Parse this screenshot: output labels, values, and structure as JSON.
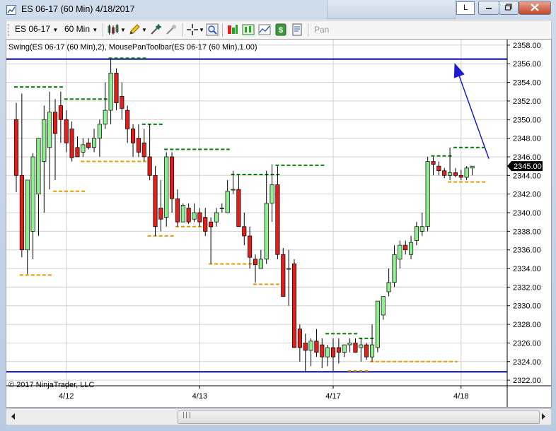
{
  "window": {
    "title": "ES 06-17 (60 Min)  4/18/2017",
    "l_button": "L"
  },
  "toolbar": {
    "instrument": "ES 06-17",
    "interval": "60 Min",
    "pan_label": "Pan"
  },
  "chart": {
    "indicator_label": "Swing(ES 06-17 (60 Min),2), MousePanToolbar(ES 06-17 (60 Min),1.00)",
    "copyright": "© 2017 NinjaTrader, LLC",
    "current_price_label": "2345.00",
    "colors": {
      "up": "#90ee90",
      "down": "#e0201c",
      "swing_high": "#008000",
      "swing_low": "#e89a00",
      "horizontal_line": "#0000a0",
      "arrow": "#1c1cd0",
      "grid": "#d0d0d0"
    }
  },
  "chart_data": {
    "type": "candlestick",
    "symbol": "ES 06-17",
    "interval": "60 Min",
    "ylim": [
      2321.4,
      2358.6
    ],
    "y_ticks": [
      2322.0,
      2324.0,
      2326.0,
      2328.0,
      2330.0,
      2332.0,
      2334.0,
      2336.0,
      2338.0,
      2340.0,
      2342.0,
      2344.0,
      2346.0,
      2348.0,
      2350.0,
      2352.0,
      2354.0,
      2356.0,
      2358.0
    ],
    "y_tick_labels": [
      "2322.00",
      "2324.00",
      "2326.00",
      "2328.00",
      "2330.00",
      "2332.00",
      "2334.00",
      "2336.00",
      "2338.00",
      "2340.00",
      "2342.00",
      "2344.00",
      "2346.00",
      "2348.00",
      "2350.00",
      "2352.00",
      "2354.00",
      "2356.00",
      "2358.00"
    ],
    "x_ticks": [
      {
        "bar": 9,
        "label": "4/12"
      },
      {
        "bar": 33,
        "label": "4/13"
      },
      {
        "bar": 57,
        "label": "4/17"
      },
      {
        "bar": 80,
        "label": "4/18"
      }
    ],
    "candles": [
      {
        "o": 2350.0,
        "h": 2351.8,
        "l": 2342.2,
        "c": 2344.0
      },
      {
        "o": 2344.0,
        "h": 2352.8,
        "l": 2335.2,
        "c": 2336.0
      },
      {
        "o": 2336.0,
        "h": 2342.5,
        "l": 2333.4,
        "c": 2343.5
      },
      {
        "o": 2338.0,
        "h": 2346.4,
        "l": 2335.0,
        "c": 2346.0
      },
      {
        "o": 2342.0,
        "h": 2348.0,
        "l": 2337.5,
        "c": 2348.0
      },
      {
        "o": 2345.5,
        "h": 2351.5,
        "l": 2340.0,
        "c": 2350.0
      },
      {
        "o": 2347.0,
        "h": 2353.0,
        "l": 2342.5,
        "c": 2350.8
      },
      {
        "o": 2350.8,
        "h": 2352.2,
        "l": 2343.5,
        "c": 2348.5
      },
      {
        "o": 2351.5,
        "h": 2353.0,
        "l": 2347.5,
        "c": 2350.0
      },
      {
        "o": 2350.0,
        "h": 2351.0,
        "l": 2346.5,
        "c": 2347.5
      },
      {
        "o": 2349.0,
        "h": 2349.8,
        "l": 2345.5,
        "c": 2345.9
      },
      {
        "o": 2347.0,
        "h": 2348.2,
        "l": 2346.0,
        "c": 2346.0
      },
      {
        "o": 2346.5,
        "h": 2348.0,
        "l": 2346.0,
        "c": 2347.3
      },
      {
        "o": 2347.5,
        "h": 2348.0,
        "l": 2346.8,
        "c": 2347.0
      },
      {
        "o": 2347.0,
        "h": 2349.0,
        "l": 2346.5,
        "c": 2348.0
      },
      {
        "o": 2348.0,
        "h": 2350.0,
        "l": 2346.0,
        "c": 2349.5
      },
      {
        "o": 2349.5,
        "h": 2354.0,
        "l": 2349.0,
        "c": 2351.0
      },
      {
        "o": 2351.0,
        "h": 2356.5,
        "l": 2349.5,
        "c": 2355.0
      },
      {
        "o": 2355.0,
        "h": 2355.5,
        "l": 2351.0,
        "c": 2351.8
      },
      {
        "o": 2352.5,
        "h": 2354.0,
        "l": 2350.0,
        "c": 2351.2
      },
      {
        "o": 2351.0,
        "h": 2351.5,
        "l": 2347.5,
        "c": 2349.0
      },
      {
        "o": 2349.0,
        "h": 2349.5,
        "l": 2346.0,
        "c": 2347.5
      },
      {
        "o": 2348.0,
        "h": 2349.5,
        "l": 2346.0,
        "c": 2346.5
      },
      {
        "o": 2347.5,
        "h": 2349.0,
        "l": 2345.5,
        "c": 2346.0
      },
      {
        "o": 2346.0,
        "h": 2349.5,
        "l": 2343.5,
        "c": 2344.0
      },
      {
        "o": 2344.0,
        "h": 2345.0,
        "l": 2337.5,
        "c": 2338.5
      },
      {
        "o": 2340.5,
        "h": 2343.5,
        "l": 2338.0,
        "c": 2339.3
      },
      {
        "o": 2339.5,
        "h": 2346.5,
        "l": 2338.5,
        "c": 2346.0
      },
      {
        "o": 2346.0,
        "h": 2346.5,
        "l": 2340.0,
        "c": 2341.5
      },
      {
        "o": 2341.5,
        "h": 2342.5,
        "l": 2338.5,
        "c": 2339.0
      },
      {
        "o": 2339.0,
        "h": 2341.0,
        "l": 2339.0,
        "c": 2340.8
      },
      {
        "o": 2340.5,
        "h": 2341.0,
        "l": 2338.8,
        "c": 2339.0
      },
      {
        "o": 2339.3,
        "h": 2341.0,
        "l": 2339.0,
        "c": 2340.0
      },
      {
        "o": 2340.0,
        "h": 2340.5,
        "l": 2338.5,
        "c": 2339.0
      },
      {
        "o": 2339.5,
        "h": 2340.5,
        "l": 2337.5,
        "c": 2338.0
      },
      {
        "o": 2339.0,
        "h": 2339.5,
        "l": 2334.5,
        "c": 2338.5
      },
      {
        "o": 2339.0,
        "h": 2340.5,
        "l": 2338.5,
        "c": 2340.0
      },
      {
        "o": 2340.5,
        "h": 2341.0,
        "l": 2340.0,
        "c": 2340.5
      },
      {
        "o": 2340.0,
        "h": 2343.5,
        "l": 2340.0,
        "c": 2342.3
      },
      {
        "o": 2342.5,
        "h": 2344.5,
        "l": 2342.0,
        "c": 2342.5
      },
      {
        "o": 2342.5,
        "h": 2344.0,
        "l": 2338.5,
        "c": 2338.5
      },
      {
        "o": 2338.5,
        "h": 2340.0,
        "l": 2336.5,
        "c": 2337.5
      },
      {
        "o": 2337.5,
        "h": 2338.5,
        "l": 2334.0,
        "c": 2335.2
      },
      {
        "o": 2335.0,
        "h": 2335.5,
        "l": 2332.5,
        "c": 2334.4
      },
      {
        "o": 2334.0,
        "h": 2336.0,
        "l": 2334.0,
        "c": 2335.0
      },
      {
        "o": 2335.0,
        "h": 2344.5,
        "l": 2334.5,
        "c": 2341.0
      },
      {
        "o": 2341.0,
        "h": 2345.2,
        "l": 2339.0,
        "c": 2343.0
      },
      {
        "o": 2343.0,
        "h": 2345.0,
        "l": 2335.0,
        "c": 2335.5
      },
      {
        "o": 2335.5,
        "h": 2336.2,
        "l": 2331.0,
        "c": 2331.0
      },
      {
        "o": 2334.0,
        "h": 2336.0,
        "l": 2330.0,
        "c": 2334.0
      },
      {
        "o": 2334.5,
        "h": 2335.0,
        "l": 2326.0,
        "c": 2325.5
      },
      {
        "o": 2327.5,
        "h": 2328.0,
        "l": 2324.0,
        "c": 2325.5
      },
      {
        "o": 2326.0,
        "h": 2327.0,
        "l": 2323.0,
        "c": 2325.2
      },
      {
        "o": 2325.2,
        "h": 2326.5,
        "l": 2323.5,
        "c": 2326.2
      },
      {
        "o": 2326.2,
        "h": 2327.5,
        "l": 2324.5,
        "c": 2325.0
      },
      {
        "o": 2325.8,
        "h": 2326.5,
        "l": 2323.3,
        "c": 2324.5
      },
      {
        "o": 2324.5,
        "h": 2325.8,
        "l": 2323.5,
        "c": 2325.5
      },
      {
        "o": 2325.5,
        "h": 2326.5,
        "l": 2323.0,
        "c": 2324.5
      },
      {
        "o": 2325.5,
        "h": 2326.5,
        "l": 2323.8,
        "c": 2325.0
      },
      {
        "o": 2325.0,
        "h": 2325.8,
        "l": 2324.5,
        "c": 2325.8
      },
      {
        "o": 2325.8,
        "h": 2326.5,
        "l": 2325.0,
        "c": 2326.0
      },
      {
        "o": 2326.0,
        "h": 2326.5,
        "l": 2325.0,
        "c": 2325.0
      },
      {
        "o": 2325.5,
        "h": 2326.5,
        "l": 2324.0,
        "c": 2325.8
      },
      {
        "o": 2325.8,
        "h": 2326.0,
        "l": 2324.2,
        "c": 2324.5
      },
      {
        "o": 2324.5,
        "h": 2328.0,
        "l": 2324.0,
        "c": 2325.8
      },
      {
        "o": 2325.5,
        "h": 2327.5,
        "l": 2325.0,
        "c": 2330.5
      },
      {
        "o": 2329.0,
        "h": 2331.0,
        "l": 2328.5,
        "c": 2331.0
      },
      {
        "o": 2331.5,
        "h": 2334.0,
        "l": 2331.0,
        "c": 2332.5
      },
      {
        "o": 2332.5,
        "h": 2336.5,
        "l": 2332.0,
        "c": 2335.5
      },
      {
        "o": 2335.0,
        "h": 2337.0,
        "l": 2334.0,
        "c": 2336.5
      },
      {
        "o": 2336.5,
        "h": 2337.0,
        "l": 2335.5,
        "c": 2336.0
      },
      {
        "o": 2335.5,
        "h": 2337.5,
        "l": 2335.0,
        "c": 2336.8
      },
      {
        "o": 2337.0,
        "h": 2339.0,
        "l": 2336.5,
        "c": 2338.5
      },
      {
        "o": 2338.0,
        "h": 2340.0,
        "l": 2337.5,
        "c": 2338.5
      },
      {
        "o": 2338.5,
        "h": 2346.0,
        "l": 2338.0,
        "c": 2345.5
      },
      {
        "o": 2345.5,
        "h": 2346.0,
        "l": 2344.0,
        "c": 2345.2
      },
      {
        "o": 2345.0,
        "h": 2345.5,
        "l": 2344.0,
        "c": 2344.5
      },
      {
        "o": 2344.5,
        "h": 2344.8,
        "l": 2343.7,
        "c": 2344.0
      },
      {
        "o": 2344.0,
        "h": 2347.0,
        "l": 2343.5,
        "c": 2344.3
      },
      {
        "o": 2344.3,
        "h": 2344.8,
        "l": 2343.8,
        "c": 2344.0
      },
      {
        "o": 2344.0,
        "h": 2344.6,
        "l": 2343.5,
        "c": 2343.8
      },
      {
        "o": 2343.8,
        "h": 2345.0,
        "l": 2343.5,
        "c": 2344.8
      },
      {
        "o": 2344.8,
        "h": 2345.0,
        "l": 2344.0,
        "c": 2345.0
      }
    ],
    "swing_highs": [
      {
        "from": 0,
        "to": 8,
        "price": 2353.5
      },
      {
        "from": 9,
        "to": 17,
        "price": 2352.2
      },
      {
        "from": 17,
        "to": 23,
        "price": 2356.6
      },
      {
        "from": 23,
        "to": 26,
        "price": 2349.5
      },
      {
        "from": 27,
        "to": 38,
        "price": 2346.8
      },
      {
        "from": 39,
        "to": 47,
        "price": 2344.1
      },
      {
        "from": 47,
        "to": 55,
        "price": 2345.1
      },
      {
        "from": 56,
        "to": 61,
        "price": 2327.0
      },
      {
        "from": 62,
        "to": 65,
        "price": 2326.5
      },
      {
        "from": 75,
        "to": 78,
        "price": 2346.1
      },
      {
        "from": 79,
        "to": 84,
        "price": 2347.0
      }
    ],
    "swing_lows": [
      {
        "from": 1,
        "to": 6,
        "price": 2333.3
      },
      {
        "from": 7,
        "to": 12,
        "price": 2342.3
      },
      {
        "from": 12,
        "to": 23,
        "price": 2345.5
      },
      {
        "from": 24,
        "to": 28,
        "price": 2337.5
      },
      {
        "from": 29,
        "to": 35,
        "price": 2338.5
      },
      {
        "from": 35,
        "to": 42,
        "price": 2334.5
      },
      {
        "from": 43,
        "to": 48,
        "price": 2332.3
      },
      {
        "from": 60,
        "to": 63,
        "price": 2323.0
      },
      {
        "from": 64,
        "to": 79,
        "price": 2324.0
      },
      {
        "from": 78,
        "to": 84,
        "price": 2343.3
      }
    ],
    "horizontal_lines": [
      2356.5,
      2322.9
    ],
    "trend_arrow": {
      "from_bar": 85,
      "from_price": 2345.8,
      "to_bar": 79,
      "to_price": 2355.8
    }
  }
}
